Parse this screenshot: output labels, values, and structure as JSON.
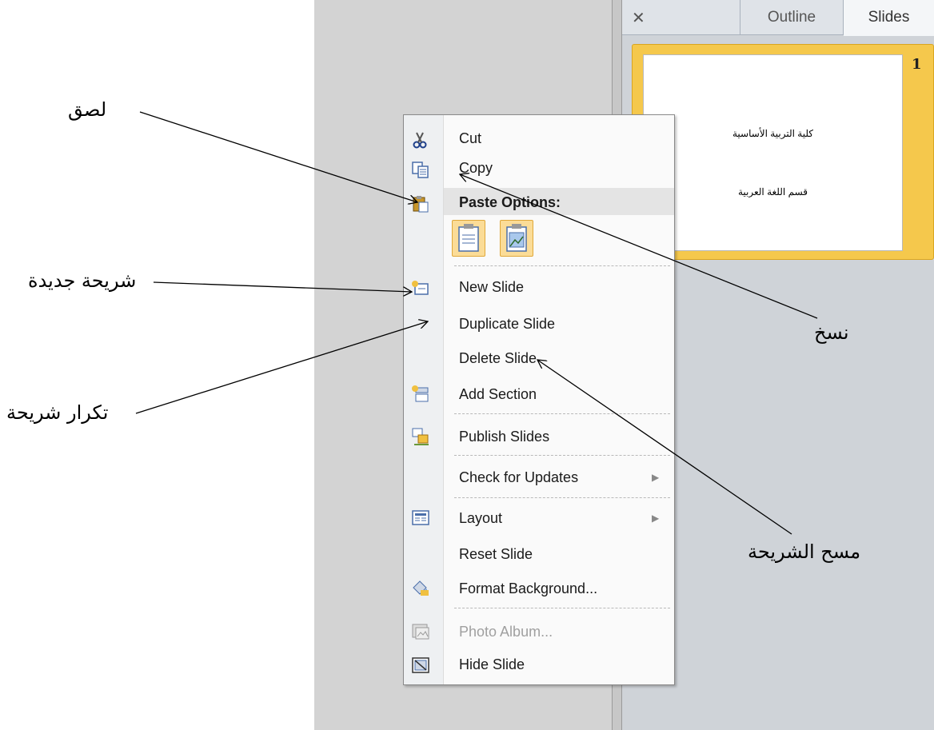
{
  "panel": {
    "close_glyph": "✕",
    "tabs": [
      "Outline",
      "Slides"
    ],
    "slide_number": "1",
    "slide_lines": [
      "كلية التربية الأساسية",
      "قسم اللغة العربية"
    ]
  },
  "menu": {
    "items": [
      {
        "label": "Cut",
        "icon": "scissors-icon"
      },
      {
        "label": "Copy",
        "icon": "copy-icon"
      },
      {
        "label": "Paste Options:",
        "icon": "paste-icon"
      },
      {
        "label": "New Slide",
        "icon": "new-slide-icon"
      },
      {
        "label": "Duplicate Slide",
        "icon": ""
      },
      {
        "label": "Delete Slide",
        "icon": ""
      },
      {
        "label": "Add Section",
        "icon": "add-section-icon"
      },
      {
        "label": "Publish Slides",
        "icon": "publish-slides-icon"
      },
      {
        "label": "Check for Updates",
        "icon": ""
      },
      {
        "label": "Layout",
        "icon": "layout-icon"
      },
      {
        "label": "Reset Slide",
        "icon": ""
      },
      {
        "label": "Format Background...",
        "icon": "format-background-icon"
      },
      {
        "label": "Photo Album...",
        "icon": "photo-album-icon"
      },
      {
        "label": "Hide Slide",
        "icon": "hide-slide-icon"
      }
    ],
    "paste_buttons": [
      "paste-keep-formatting-icon",
      "paste-picture-icon"
    ]
  },
  "annotations": {
    "paste": "لصق",
    "new_slide": "شريحة جديدة",
    "duplicate_slide": "تكرار شريحة",
    "copy": "نسخ",
    "delete_slide": "مسح الشريحة"
  }
}
